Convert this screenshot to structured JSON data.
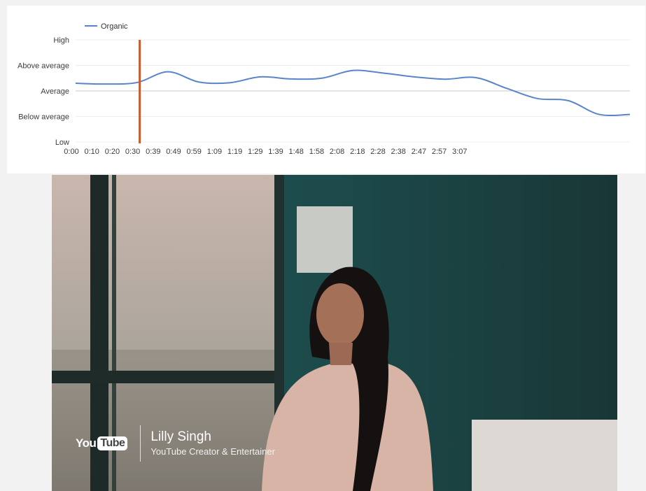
{
  "chart_data": {
    "type": "line",
    "series": [
      {
        "name": "Organic",
        "color": "#5a84c9",
        "values": [
          2.3,
          2.27,
          2.33,
          2.75,
          2.35,
          2.32,
          2.55,
          2.47,
          2.5,
          2.8,
          2.7,
          2.55,
          2.46,
          2.52,
          2.1,
          1.7,
          1.62,
          1.08,
          1.08
        ]
      }
    ],
    "x": [
      "0:00",
      "0:10",
      "0:20",
      "0:30",
      "0:39",
      "0:49",
      "0:59",
      "1:09",
      "1:19",
      "1:29",
      "1:39",
      "1:48",
      "1:58",
      "2:08",
      "2:18",
      "2:28",
      "2:38",
      "2:47",
      "2:57",
      "3:07"
    ],
    "y_ticks": [
      "Low",
      "Below average",
      "Average",
      "Above average",
      "High"
    ],
    "ylim": [
      0,
      4
    ],
    "legend": "top-left",
    "grid": true,
    "marker": {
      "x": "0:30",
      "color": "#c65c2c"
    }
  },
  "video": {
    "logo_you": "You",
    "logo_tube": "Tube",
    "name": "Lilly Singh",
    "role": "YouTube Creator & Entertainer"
  }
}
